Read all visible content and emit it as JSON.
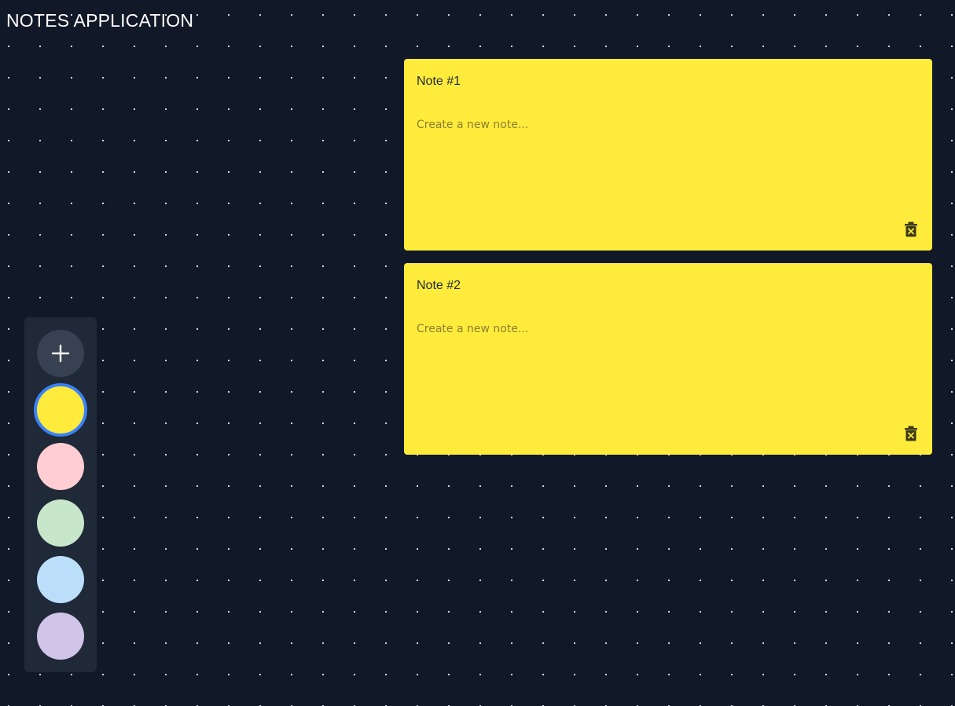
{
  "app": {
    "title": "NOTES APPLICATION"
  },
  "toolbar": {
    "add_button_icon": "plus-icon",
    "selected_color": "#ffeb3b",
    "colors": [
      {
        "name": "yellow",
        "hex": "#ffeb3b"
      },
      {
        "name": "pink",
        "hex": "#ffcdd2"
      },
      {
        "name": "green",
        "hex": "#c8e6c9"
      },
      {
        "name": "blue",
        "hex": "#bbdefb"
      },
      {
        "name": "purple",
        "hex": "#d1c4e9"
      }
    ]
  },
  "notes": [
    {
      "title": "Note #1",
      "body": "",
      "placeholder": "Create a new note...",
      "color": "#ffeb3b",
      "delete_icon": "trash-icon"
    },
    {
      "title": "Note #2",
      "body": "",
      "placeholder": "Create a new note...",
      "color": "#ffeb3b",
      "delete_icon": "trash-icon"
    }
  ]
}
